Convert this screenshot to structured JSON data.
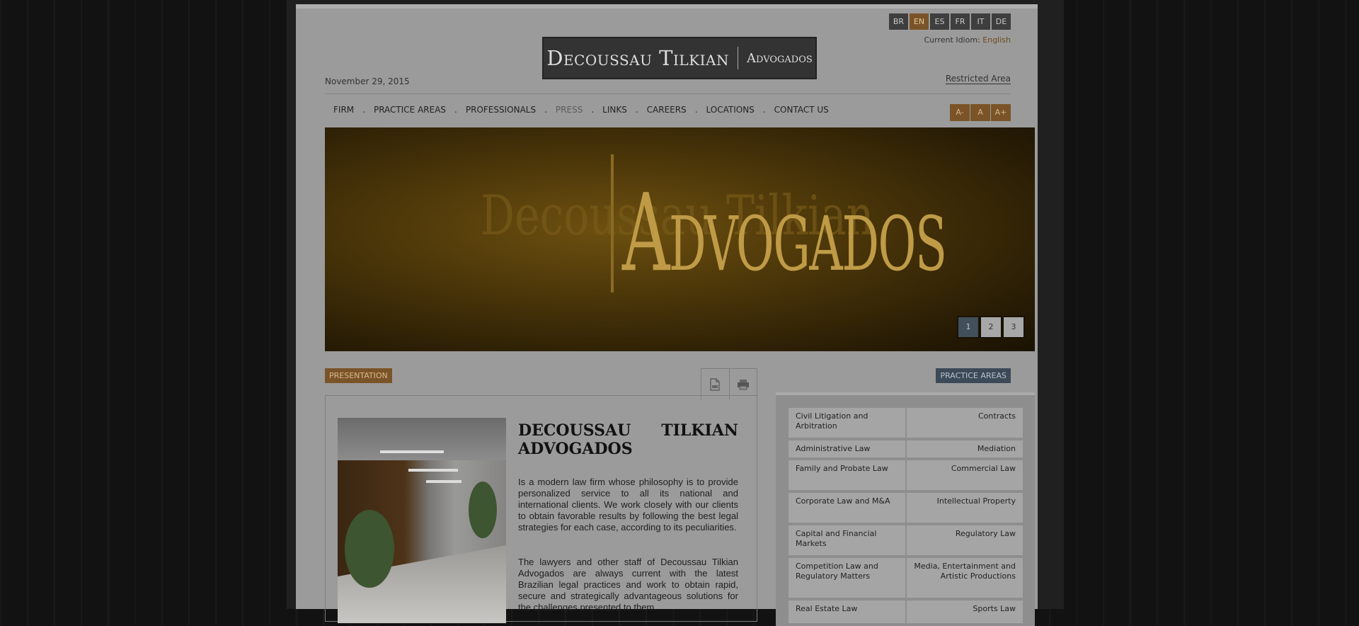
{
  "languages": {
    "items": [
      "BR",
      "EN",
      "ES",
      "FR",
      "IT",
      "DE"
    ],
    "active_index": 1,
    "current_label": "Current Idiom:",
    "current_value": "English"
  },
  "logo": {
    "name": "Decoussau Tilkian",
    "suffix": "Advogados"
  },
  "header": {
    "date": "November 29, 2015",
    "restricted": "Restricted Area"
  },
  "nav": [
    "FIRM",
    "PRACTICE AREAS",
    "PROFESSIONALS",
    "PRESS",
    "LINKS",
    "CAREERS",
    "LOCATIONS",
    "CONTACT US"
  ],
  "font_controls": [
    "A-",
    "A",
    "A+"
  ],
  "hero": {
    "ghost_text": "Decoussau Tilkian",
    "word": "Advogados",
    "pages": [
      "1",
      "2",
      "3"
    ],
    "active_page": 0
  },
  "presentation": {
    "tag": "PRESENTATION",
    "title_line1": "DECOUSSAU TILKIAN",
    "title_line2": "ADVOGADOS",
    "paragraph1": "Is a modern law firm whose philosophy is to provide personalized service to all its national and international clients. We work closely with our clients to obtain favorable results by following the best legal strategies for each case, according to its peculiarities.",
    "paragraph2": "The lawyers and other staff of Decoussau Tilkian Advogados are always current with the latest Brazilian legal practices and work to obtain rapid, secure and strategically advantageous solutions for the challenges presented to them."
  },
  "practice_areas": {
    "tag": "PRACTICE AREAS",
    "items": [
      "Civil Litigation and Arbitration",
      "Contracts",
      "Administrative Law",
      "Mediation",
      "Family and Probate Law",
      "Commercial Law",
      "Corporate Law and M&A",
      "Intellectual Property",
      "Capital and Financial Markets",
      "Regulatory Law",
      "Competition Law and Regulatory Matters",
      "Media, Entertainment and Artistic Productions",
      "Real Estate Law",
      "Sports Law"
    ]
  },
  "icons": {
    "pdf": "pdf-icon",
    "print": "print-icon"
  },
  "colors": {
    "accent_gold": "#7a5428",
    "accent_blue": "#3c4a58",
    "overlay_dim": "#9b9b9b"
  }
}
